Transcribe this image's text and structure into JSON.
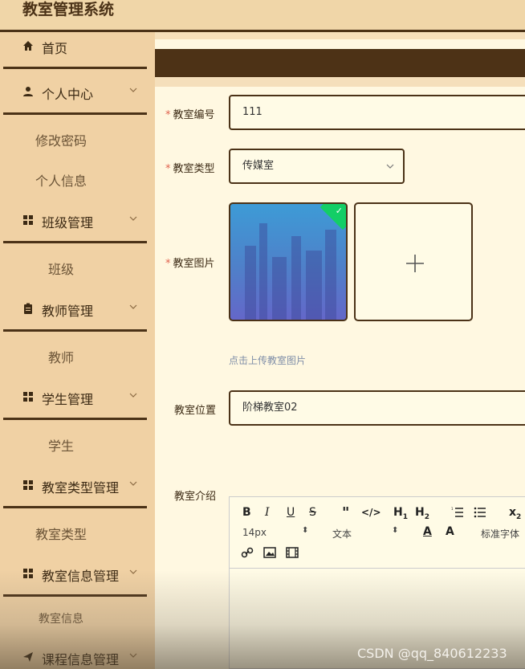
{
  "header": {
    "title": "教室管理系统"
  },
  "sidebar": {
    "items": [
      {
        "label": "首页"
      },
      {
        "label": "个人中心",
        "children": [
          "修改密码",
          "个人信息"
        ]
      },
      {
        "label": "班级管理",
        "children": [
          "班级"
        ]
      },
      {
        "label": "教师管理",
        "children": [
          "教师"
        ]
      },
      {
        "label": "学生管理",
        "children": [
          "学生"
        ]
      },
      {
        "label": "教室类型管理",
        "children": [
          "教室类型"
        ]
      },
      {
        "label": "教室信息管理",
        "children": [
          "教室信息"
        ]
      },
      {
        "label": "课程信息管理"
      }
    ]
  },
  "form": {
    "room_no": {
      "label": "教室编号",
      "value": "111"
    },
    "room_type": {
      "label": "教室类型",
      "value": "传媒室"
    },
    "room_image": {
      "label": "教室图片",
      "hint": "点击上传教室图片"
    },
    "room_location": {
      "label": "教室位置",
      "value": "阶梯教室02"
    },
    "room_intro": {
      "label": "教室介绍"
    }
  },
  "editor": {
    "font_size": "14px",
    "block_type": "文本",
    "font_family": "标准字体"
  },
  "watermark": "CSDN @qq_840612233",
  "colors": {
    "accent_dark": "#4b3217",
    "sidebar_bg": "#f0d1a4",
    "page_bg": "#fff8e1",
    "required": "#e0624f"
  }
}
